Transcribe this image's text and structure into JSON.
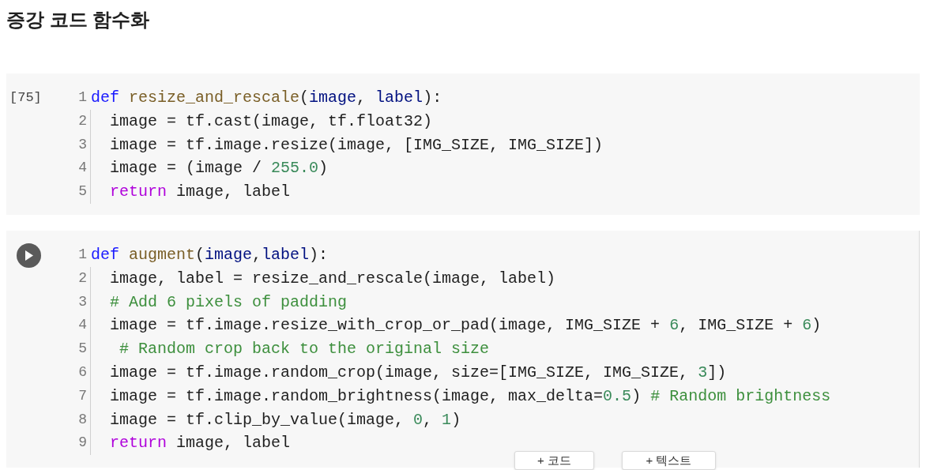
{
  "heading": "증강 코드 함수화",
  "cells": [
    {
      "execution_count": "[75]",
      "run_button": false,
      "lines": [
        {
          "n": "1",
          "tokens": [
            {
              "kind": "keyword",
              "t": "def"
            },
            {
              "kind": "function",
              "t": " resize_and_rescale"
            },
            {
              "kind": "plain",
              "t": "("
            },
            {
              "kind": "param",
              "t": "image"
            },
            {
              "kind": "plain",
              "t": ", "
            },
            {
              "kind": "param",
              "t": "label"
            },
            {
              "kind": "plain",
              "t": "):"
            }
          ]
        },
        {
          "n": "2",
          "tokens": [
            {
              "kind": "plain",
              "t": "  image = tf.cast(image, tf.float32)"
            }
          ]
        },
        {
          "n": "3",
          "tokens": [
            {
              "kind": "plain",
              "t": "  image = tf.image.resize(image, [IMG_SIZE, IMG_SIZE])"
            }
          ]
        },
        {
          "n": "4",
          "tokens": [
            {
              "kind": "plain",
              "t": "  image = (image / "
            },
            {
              "kind": "number",
              "t": "255.0"
            },
            {
              "kind": "plain",
              "t": ")"
            }
          ]
        },
        {
          "n": "5",
          "tokens": [
            {
              "kind": "control",
              "t": "  return"
            },
            {
              "kind": "plain",
              "t": " image, label"
            }
          ]
        }
      ]
    },
    {
      "run_button": true,
      "lines": [
        {
          "n": "1",
          "tokens": [
            {
              "kind": "keyword",
              "t": "def"
            },
            {
              "kind": "function",
              "t": " augment"
            },
            {
              "kind": "plain",
              "t": "("
            },
            {
              "kind": "param",
              "t": "image"
            },
            {
              "kind": "plain",
              "t": ","
            },
            {
              "kind": "param",
              "t": "label"
            },
            {
              "kind": "plain",
              "t": "):"
            }
          ]
        },
        {
          "n": "2",
          "tokens": [
            {
              "kind": "plain",
              "t": "  image, label = resize_and_rescale(image, label)"
            }
          ]
        },
        {
          "n": "3",
          "tokens": [
            {
              "kind": "comment",
              "t": "  # Add 6 pixels of padding"
            }
          ]
        },
        {
          "n": "4",
          "tokens": [
            {
              "kind": "plain",
              "t": "  image = tf.image.resize_with_crop_or_pad(image, IMG_SIZE + "
            },
            {
              "kind": "number",
              "t": "6"
            },
            {
              "kind": "plain",
              "t": ", IMG_SIZE + "
            },
            {
              "kind": "number",
              "t": "6"
            },
            {
              "kind": "plain",
              "t": ")"
            }
          ]
        },
        {
          "n": "5",
          "tokens": [
            {
              "kind": "comment",
              "t": "   # Random crop back to the original size"
            }
          ]
        },
        {
          "n": "6",
          "tokens": [
            {
              "kind": "plain",
              "t": "  image = tf.image.random_crop(image, size=[IMG_SIZE, IMG_SIZE, "
            },
            {
              "kind": "number",
              "t": "3"
            },
            {
              "kind": "plain",
              "t": "])"
            }
          ]
        },
        {
          "n": "7",
          "tokens": [
            {
              "kind": "plain",
              "t": "  image = tf.image.random_brightness(image, max_delta="
            },
            {
              "kind": "number",
              "t": "0.5"
            },
            {
              "kind": "plain",
              "t": ")"
            },
            {
              "kind": "comment",
              "t": " # Random brightness"
            }
          ]
        },
        {
          "n": "8",
          "tokens": [
            {
              "kind": "plain",
              "t": "  image = tf.clip_by_value(image, "
            },
            {
              "kind": "number",
              "t": "0"
            },
            {
              "kind": "plain",
              "t": ", "
            },
            {
              "kind": "number",
              "t": "1"
            },
            {
              "kind": "plain",
              "t": ")"
            }
          ]
        },
        {
          "n": "9",
          "tokens": [
            {
              "kind": "control",
              "t": "  return"
            },
            {
              "kind": "plain",
              "t": " image, label"
            }
          ]
        }
      ]
    }
  ],
  "add_buttons": [
    "+ 코드",
    "+ 텍스트"
  ]
}
